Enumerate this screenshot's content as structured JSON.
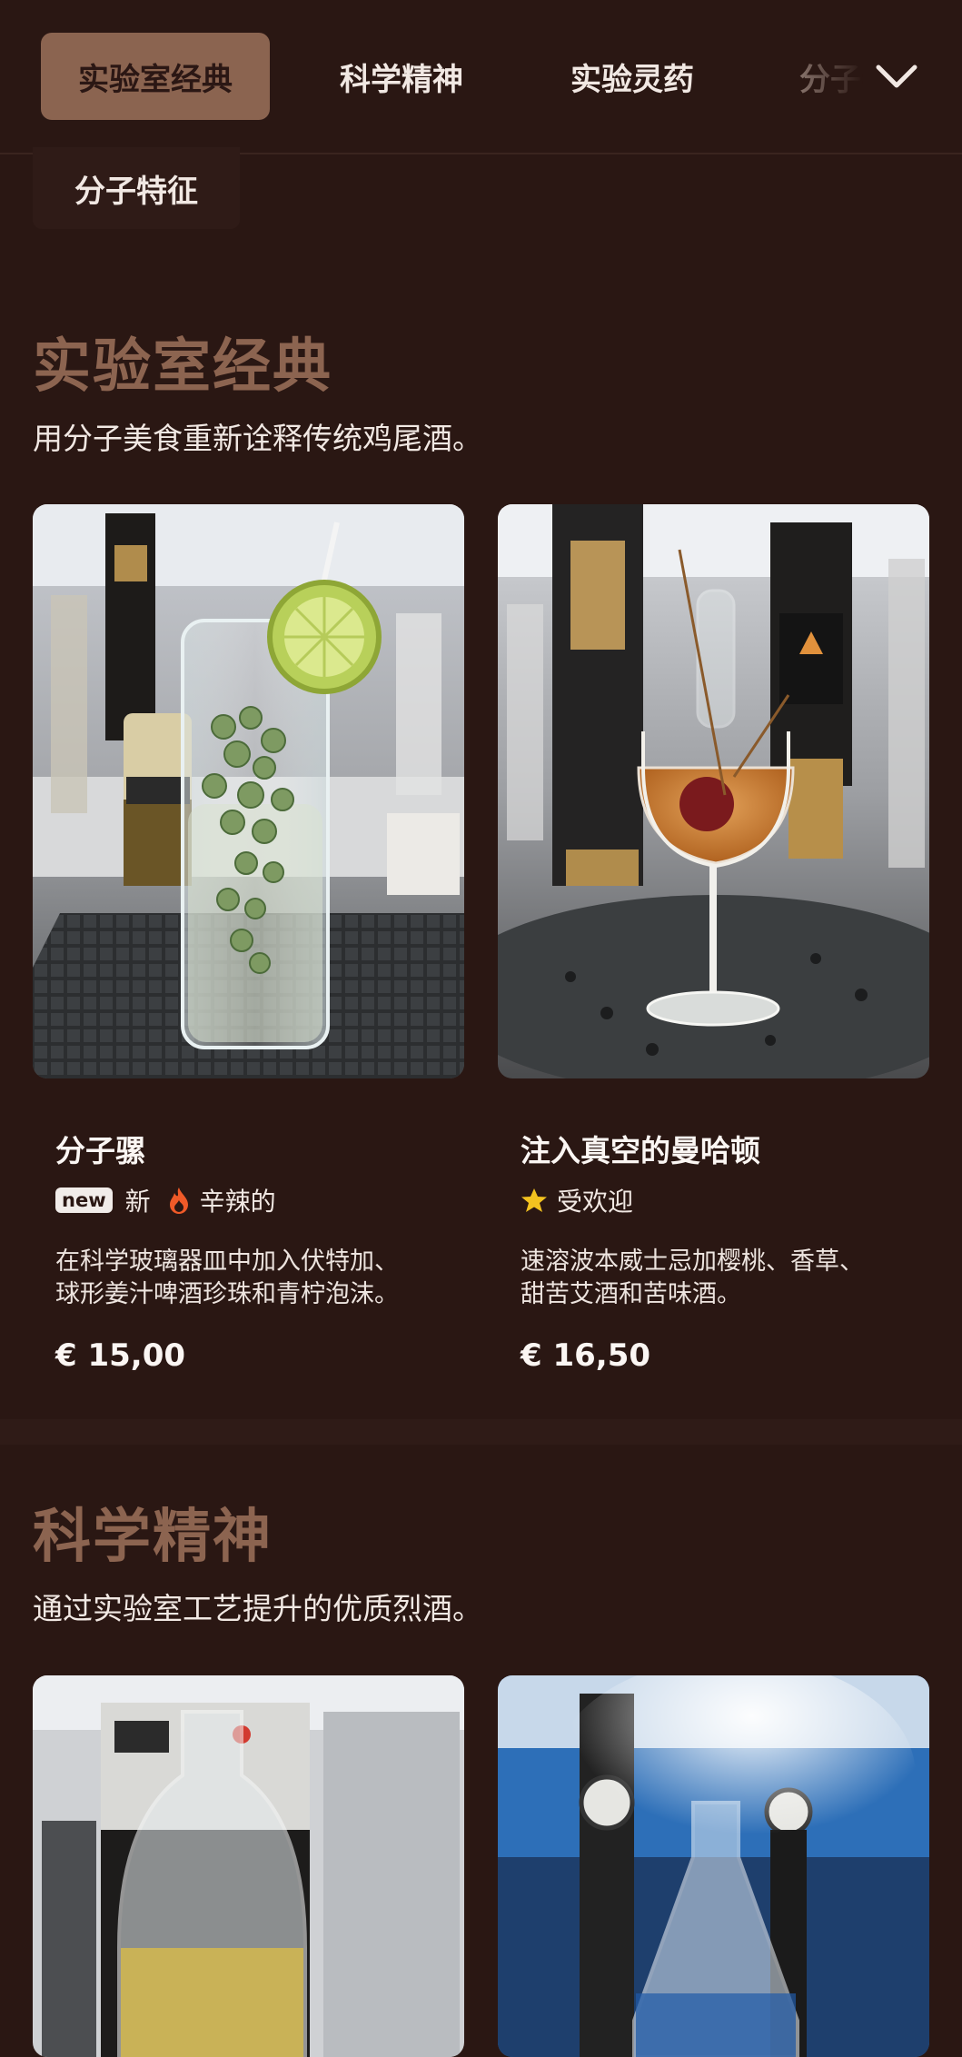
{
  "nav": {
    "tabs": [
      {
        "label": "实验室经典",
        "active": true
      },
      {
        "label": "科学精神",
        "active": false
      },
      {
        "label": "实验灵药",
        "active": false
      },
      {
        "label": "分子特征",
        "active": false
      }
    ],
    "overflow_label": "分子特征",
    "expand_icon": "chevron-down-icon"
  },
  "colors": {
    "background": "#2a1713",
    "accent": "#8c6450",
    "active_tab_bg": "#8b6450"
  },
  "sections": [
    {
      "title": "实验室经典",
      "subtitle": "用分子美食重新诠释传统鸡尾酒。",
      "items": [
        {
          "name": "分子骡",
          "tags": [
            {
              "icon": "new-badge",
              "badge": "new",
              "label": "新"
            },
            {
              "icon": "fire-icon",
              "label": "辛辣的"
            }
          ],
          "desc_line1": "在科学玻璃器皿中加入伏特加、",
          "desc_line2": "球形姜汁啤酒珍珠和青柠泡沫。",
          "price": "€ 15,00"
        },
        {
          "name": "注入真空的曼哈顿",
          "tags": [
            {
              "icon": "star-icon",
              "label": "受欢迎"
            }
          ],
          "desc_line1": "速溶波本威士忌加樱桃、香草、",
          "desc_line2": "甜苦艾酒和苦味酒。",
          "price": "€ 16,50"
        }
      ]
    },
    {
      "title": "科学精神",
      "subtitle": "通过实验室工艺提升的优质烈酒。"
    }
  ]
}
